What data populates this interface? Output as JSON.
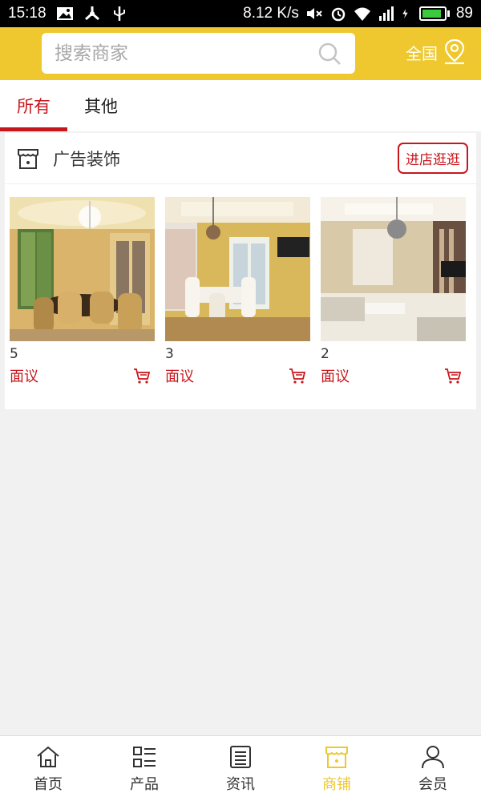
{
  "status_bar": {
    "time": "15:18",
    "speed": "8.12 K/s",
    "battery": "89",
    "battery_level": 0.89
  },
  "search": {
    "placeholder": "搜索商家",
    "region_label": "全国"
  },
  "tabs": [
    {
      "label": "所有",
      "active": true
    },
    {
      "label": "其他",
      "active": false
    }
  ],
  "shop": {
    "name": "广告装饰",
    "visit_label": "进店逛逛",
    "products": [
      {
        "count": "5",
        "price": "面议",
        "image": "dining-room-chandelier"
      },
      {
        "count": "3",
        "price": "面议",
        "image": "dining-room-floral"
      },
      {
        "count": "2",
        "price": "面议",
        "image": "living-room-modern"
      }
    ]
  },
  "bottom_nav": [
    {
      "label": "首页",
      "icon": "home-icon",
      "active": false
    },
    {
      "label": "产品",
      "icon": "list-icon",
      "active": false
    },
    {
      "label": "资讯",
      "icon": "news-icon",
      "active": false
    },
    {
      "label": "商铺",
      "icon": "store-icon",
      "active": true
    },
    {
      "label": "会员",
      "icon": "user-icon",
      "active": false
    }
  ],
  "colors": {
    "accent_yellow": "#eec82e",
    "accent_red": "#c8161d"
  }
}
